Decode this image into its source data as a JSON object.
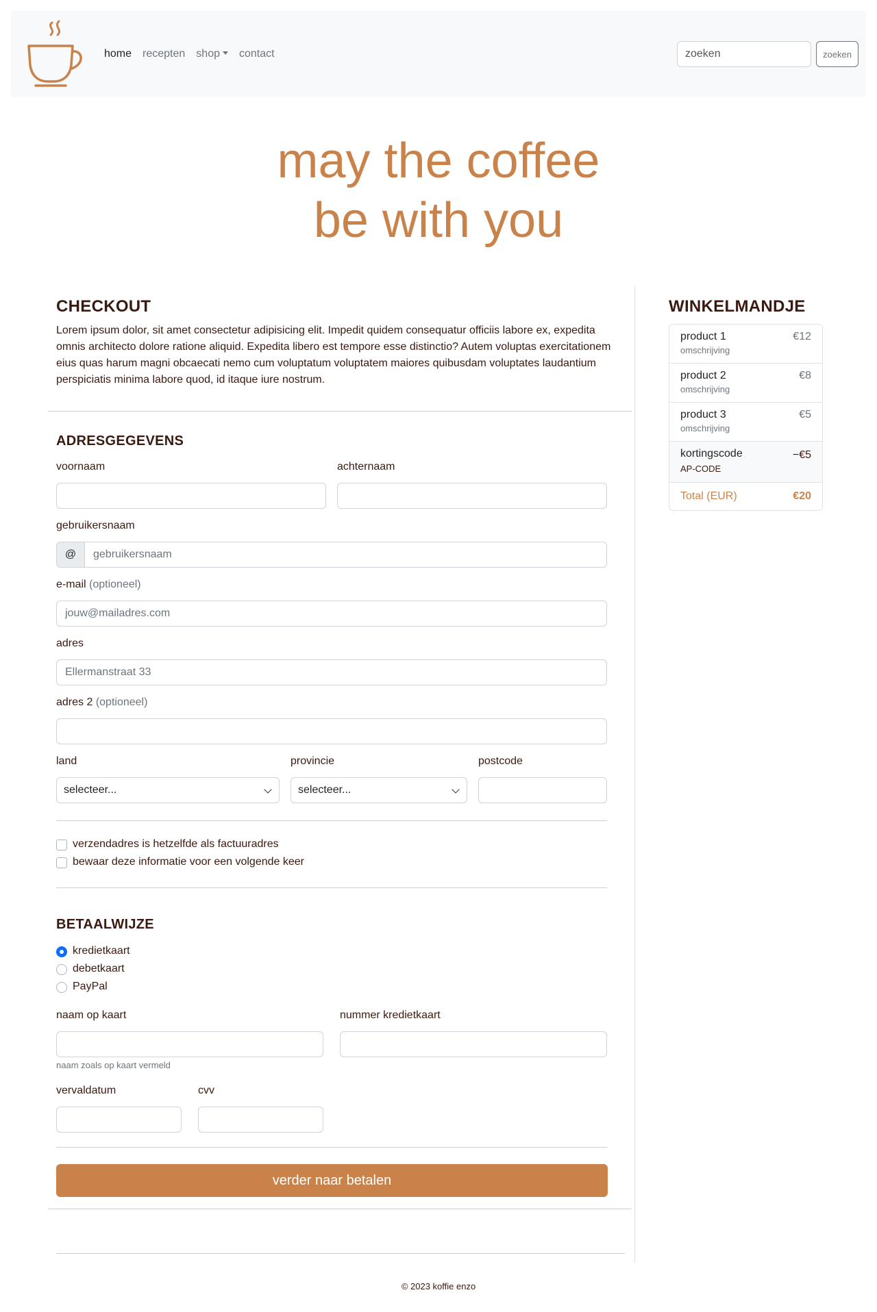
{
  "nav": {
    "items": [
      {
        "label": "home",
        "active": true
      },
      {
        "label": "recepten",
        "active": false
      },
      {
        "label": "shop",
        "active": false,
        "dropdown": true
      },
      {
        "label": "contact",
        "active": false
      }
    ],
    "search_placeholder": "zoeken",
    "search_button": "zoeken"
  },
  "hero": {
    "line1": "may the coffee",
    "line2": "be with you"
  },
  "checkout": {
    "title": "CHECKOUT",
    "intro": "Lorem ipsum dolor, sit amet consectetur adipisicing elit. Impedit quidem consequatur officiis labore ex, expedita omnis architecto dolore ratione aliquid. Expedita libero est tempore esse distinctio? Autem voluptas exercitationem eius quas harum magni obcaecati nemo cum voluptatum voluptatem maiores quibusdam voluptates laudantium perspiciatis minima labore quod, id itaque iure nostrum."
  },
  "address": {
    "title": "ADRESGEGEVENS",
    "firstname_label": "voornaam",
    "lastname_label": "achternaam",
    "username_label": "gebruikersnaam",
    "username_prefix": "@",
    "username_placeholder": "gebruikersnaam",
    "email_label": "e-mail",
    "optional": "(optioneel)",
    "email_placeholder": "jouw@mailadres.com",
    "address_label": "adres",
    "address_placeholder": "Ellermanstraat 33",
    "address2_label": "adres 2",
    "country_label": "land",
    "country_value": "selecteer...",
    "province_label": "provincie",
    "province_value": "selecteer...",
    "postcode_label": "postcode",
    "same_address": "verzendadres is hetzelfde als factuuradres",
    "save_info": "bewaar deze informatie voor een volgende keer"
  },
  "payment": {
    "title": "BETAALWIJZE",
    "methods": [
      "kredietkaart",
      "debetkaart",
      "PayPal"
    ],
    "selected": "kredietkaart",
    "card_name_label": "naam op kaart",
    "card_name_help": "naam zoals op kaart vermeld",
    "card_number_label": "nummer kredietkaart",
    "expiry_label": "vervaldatum",
    "cvv_label": "cvv",
    "submit": "verder naar betalen"
  },
  "cart": {
    "title": "WINKELMANDJE",
    "items": [
      {
        "name": "product 1",
        "desc": "omschrijving",
        "price": "€12"
      },
      {
        "name": "product 2",
        "desc": "omschrijving",
        "price": "€8"
      },
      {
        "name": "product 3",
        "desc": "omschrijving",
        "price": "€5"
      }
    ],
    "code": {
      "name": "kortingscode",
      "desc": "AP-CODE",
      "price": "−€5"
    },
    "total_label": "Total (EUR)",
    "total_value": "€20"
  },
  "footer": {
    "text": "© 2023 koffie enzo"
  },
  "colors": {
    "accent": "#c9834a",
    "heading": "#3a1a10",
    "radio": "#0d6efd"
  }
}
